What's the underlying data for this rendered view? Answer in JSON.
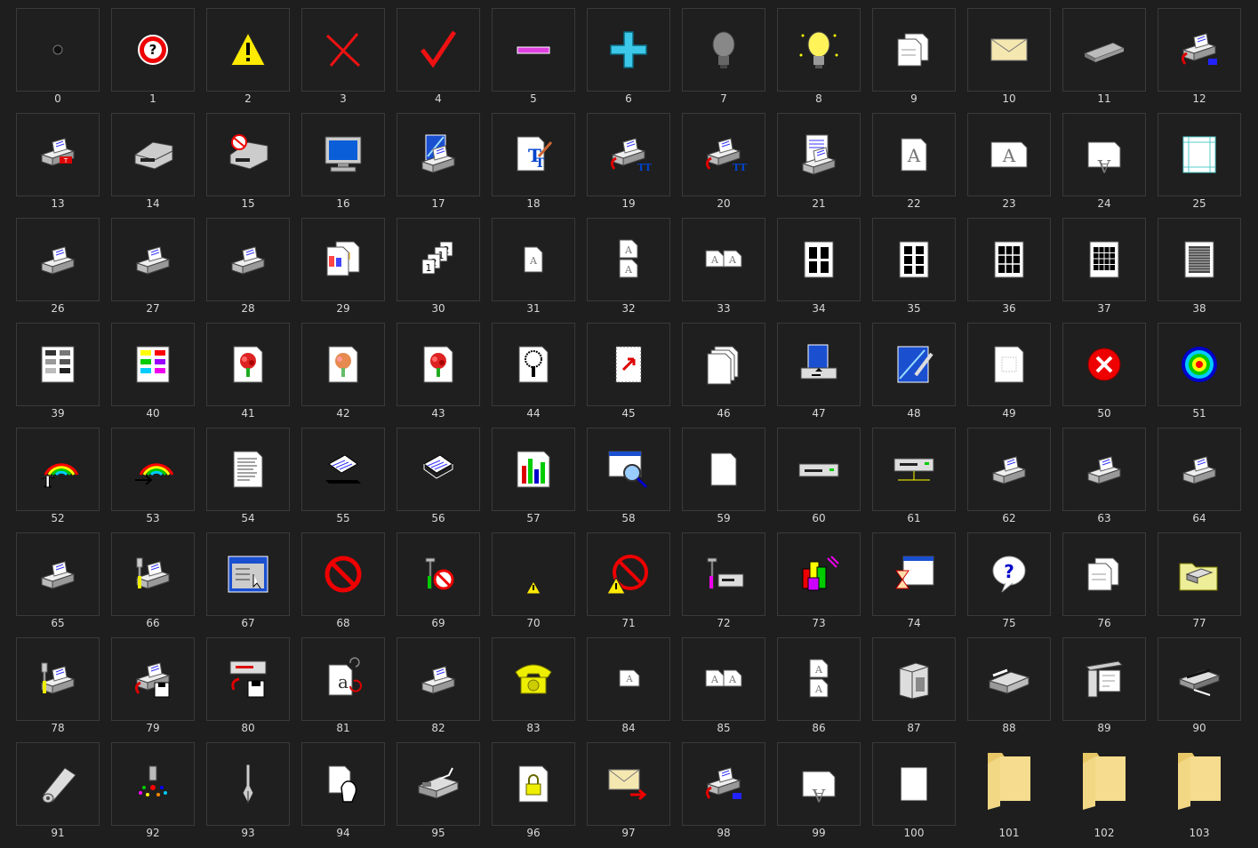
{
  "icons": [
    {
      "label": "0",
      "icon": "dot-icon"
    },
    {
      "label": "1",
      "icon": "help-icon"
    },
    {
      "label": "2",
      "icon": "warning-icon"
    },
    {
      "label": "3",
      "icon": "x-mark-icon"
    },
    {
      "label": "4",
      "icon": "check-mark-icon"
    },
    {
      "label": "5",
      "icon": "minus-icon"
    },
    {
      "label": "6",
      "icon": "plus-icon"
    },
    {
      "label": "7",
      "icon": "light-bulb-off-icon"
    },
    {
      "label": "8",
      "icon": "light-bulb-on-icon"
    },
    {
      "label": "9",
      "icon": "documents-icon"
    },
    {
      "label": "10",
      "icon": "envelope-icon"
    },
    {
      "label": "11",
      "icon": "memory-chip-icon"
    },
    {
      "label": "12",
      "icon": "printer-arrow-icon"
    },
    {
      "label": "13",
      "icon": "printer-font-icon"
    },
    {
      "label": "14",
      "icon": "laser-printer-icon"
    },
    {
      "label": "15",
      "icon": "laser-printer-error-icon"
    },
    {
      "label": "16",
      "icon": "monitor-icon"
    },
    {
      "label": "17",
      "icon": "printer-image-icon"
    },
    {
      "label": "18",
      "icon": "truetype-font-icon"
    },
    {
      "label": "19",
      "icon": "printer-truetype-icon"
    },
    {
      "label": "20",
      "icon": "printer-truetype-icon"
    },
    {
      "label": "21",
      "icon": "printer-document-icon"
    },
    {
      "label": "22",
      "icon": "page-portrait-icon"
    },
    {
      "label": "23",
      "icon": "page-landscape-icon"
    },
    {
      "label": "24",
      "icon": "page-rotated-icon"
    },
    {
      "label": "25",
      "icon": "page-margins-icon"
    },
    {
      "label": "26",
      "icon": "printer-icon"
    },
    {
      "label": "27",
      "icon": "printer-icon"
    },
    {
      "label": "28",
      "icon": "printer-icon"
    },
    {
      "label": "29",
      "icon": "color-pages-icon"
    },
    {
      "label": "30",
      "icon": "collate-icon"
    },
    {
      "label": "31",
      "icon": "one-page-icon"
    },
    {
      "label": "32",
      "icon": "two-pages-icon"
    },
    {
      "label": "33",
      "icon": "two-pages-side-icon"
    },
    {
      "label": "34",
      "icon": "four-pages-icon"
    },
    {
      "label": "35",
      "icon": "six-pages-icon"
    },
    {
      "label": "36",
      "icon": "nine-pages-icon"
    },
    {
      "label": "37",
      "icon": "sixteen-pages-icon"
    },
    {
      "label": "38",
      "icon": "many-pages-icon"
    },
    {
      "label": "39",
      "icon": "grayscale-icon"
    },
    {
      "label": "40",
      "icon": "color-palette-icon"
    },
    {
      "label": "41",
      "icon": "flower-image-icon"
    },
    {
      "label": "42",
      "icon": "flower-image-dithered-icon"
    },
    {
      "label": "43",
      "icon": "flower-image-icon"
    },
    {
      "label": "44",
      "icon": "tree-image-icon"
    },
    {
      "label": "45",
      "icon": "page-arrow-icon"
    },
    {
      "label": "46",
      "icon": "stacked-pages-icon"
    },
    {
      "label": "47",
      "icon": "paper-tray-icon"
    },
    {
      "label": "48",
      "icon": "pen-picture-icon"
    },
    {
      "label": "49",
      "icon": "watermark-page-icon"
    },
    {
      "label": "50",
      "icon": "error-circle-icon"
    },
    {
      "label": "51",
      "icon": "color-target-icon"
    },
    {
      "label": "52",
      "icon": "rainbow-font-icon"
    },
    {
      "label": "53",
      "icon": "rainbow-arrow-icon"
    },
    {
      "label": "54",
      "icon": "text-page-icon"
    },
    {
      "label": "55",
      "icon": "paper-feed-icon"
    },
    {
      "label": "56",
      "icon": "paper-stack-icon"
    },
    {
      "label": "57",
      "icon": "bar-chart-icon"
    },
    {
      "label": "58",
      "icon": "window-search-icon"
    },
    {
      "label": "59",
      "icon": "blank-page-icon"
    },
    {
      "label": "60",
      "icon": "drive-icon"
    },
    {
      "label": "61",
      "icon": "network-drive-icon"
    },
    {
      "label": "62",
      "icon": "printer-icon"
    },
    {
      "label": "63",
      "icon": "printer-icon"
    },
    {
      "label": "64",
      "icon": "printer-icon"
    },
    {
      "label": "65",
      "icon": "printer-icon"
    },
    {
      "label": "66",
      "icon": "printer-wrench-icon"
    },
    {
      "label": "67",
      "icon": "window-properties-icon"
    },
    {
      "label": "68",
      "icon": "no-entry-icon"
    },
    {
      "label": "69",
      "icon": "tools-blocked-icon"
    },
    {
      "label": "70",
      "icon": "small-warning-icon"
    },
    {
      "label": "71",
      "icon": "blocked-warning-icon"
    },
    {
      "label": "72",
      "icon": "tools-device-icon"
    },
    {
      "label": "73",
      "icon": "colorful-blocks-icon"
    },
    {
      "label": "74",
      "icon": "hourglass-window-icon"
    },
    {
      "label": "75",
      "icon": "help-bubble-icon"
    },
    {
      "label": "76",
      "icon": "documents-icon"
    },
    {
      "label": "77",
      "icon": "printer-folder-icon"
    },
    {
      "label": "78",
      "icon": "printer-wrench-icon"
    },
    {
      "label": "79",
      "icon": "printer-disk-icon"
    },
    {
      "label": "80",
      "icon": "drive-disk-icon"
    },
    {
      "label": "81",
      "icon": "font-refresh-icon"
    },
    {
      "label": "82",
      "icon": "printer-icon"
    },
    {
      "label": "83",
      "icon": "telephone-icon"
    },
    {
      "label": "84",
      "icon": "one-page-landscape-icon"
    },
    {
      "label": "85",
      "icon": "two-pages-side-icon"
    },
    {
      "label": "86",
      "icon": "two-pages-icon"
    },
    {
      "label": "87",
      "icon": "large-printer-icon"
    },
    {
      "label": "88",
      "icon": "scanner-icon"
    },
    {
      "label": "89",
      "icon": "plotter-icon"
    },
    {
      "label": "90",
      "icon": "dot-matrix-printer-icon"
    },
    {
      "label": "91",
      "icon": "paper-roll-icon"
    },
    {
      "label": "92",
      "icon": "ink-spray-icon"
    },
    {
      "label": "93",
      "icon": "pen-nib-icon"
    },
    {
      "label": "94",
      "icon": "hand-document-icon"
    },
    {
      "label": "95",
      "icon": "fax-icon"
    },
    {
      "label": "96",
      "icon": "locked-page-icon"
    },
    {
      "label": "97",
      "icon": "envelope-send-icon"
    },
    {
      "label": "98",
      "icon": "printer-arrow-icon"
    },
    {
      "label": "99",
      "icon": "page-rotated-icon"
    },
    {
      "label": "100",
      "icon": "white-page-icon"
    },
    {
      "label": "101",
      "icon": "folder-icon"
    },
    {
      "label": "102",
      "icon": "folder-icon"
    },
    {
      "label": "103",
      "icon": "folder-icon"
    }
  ]
}
